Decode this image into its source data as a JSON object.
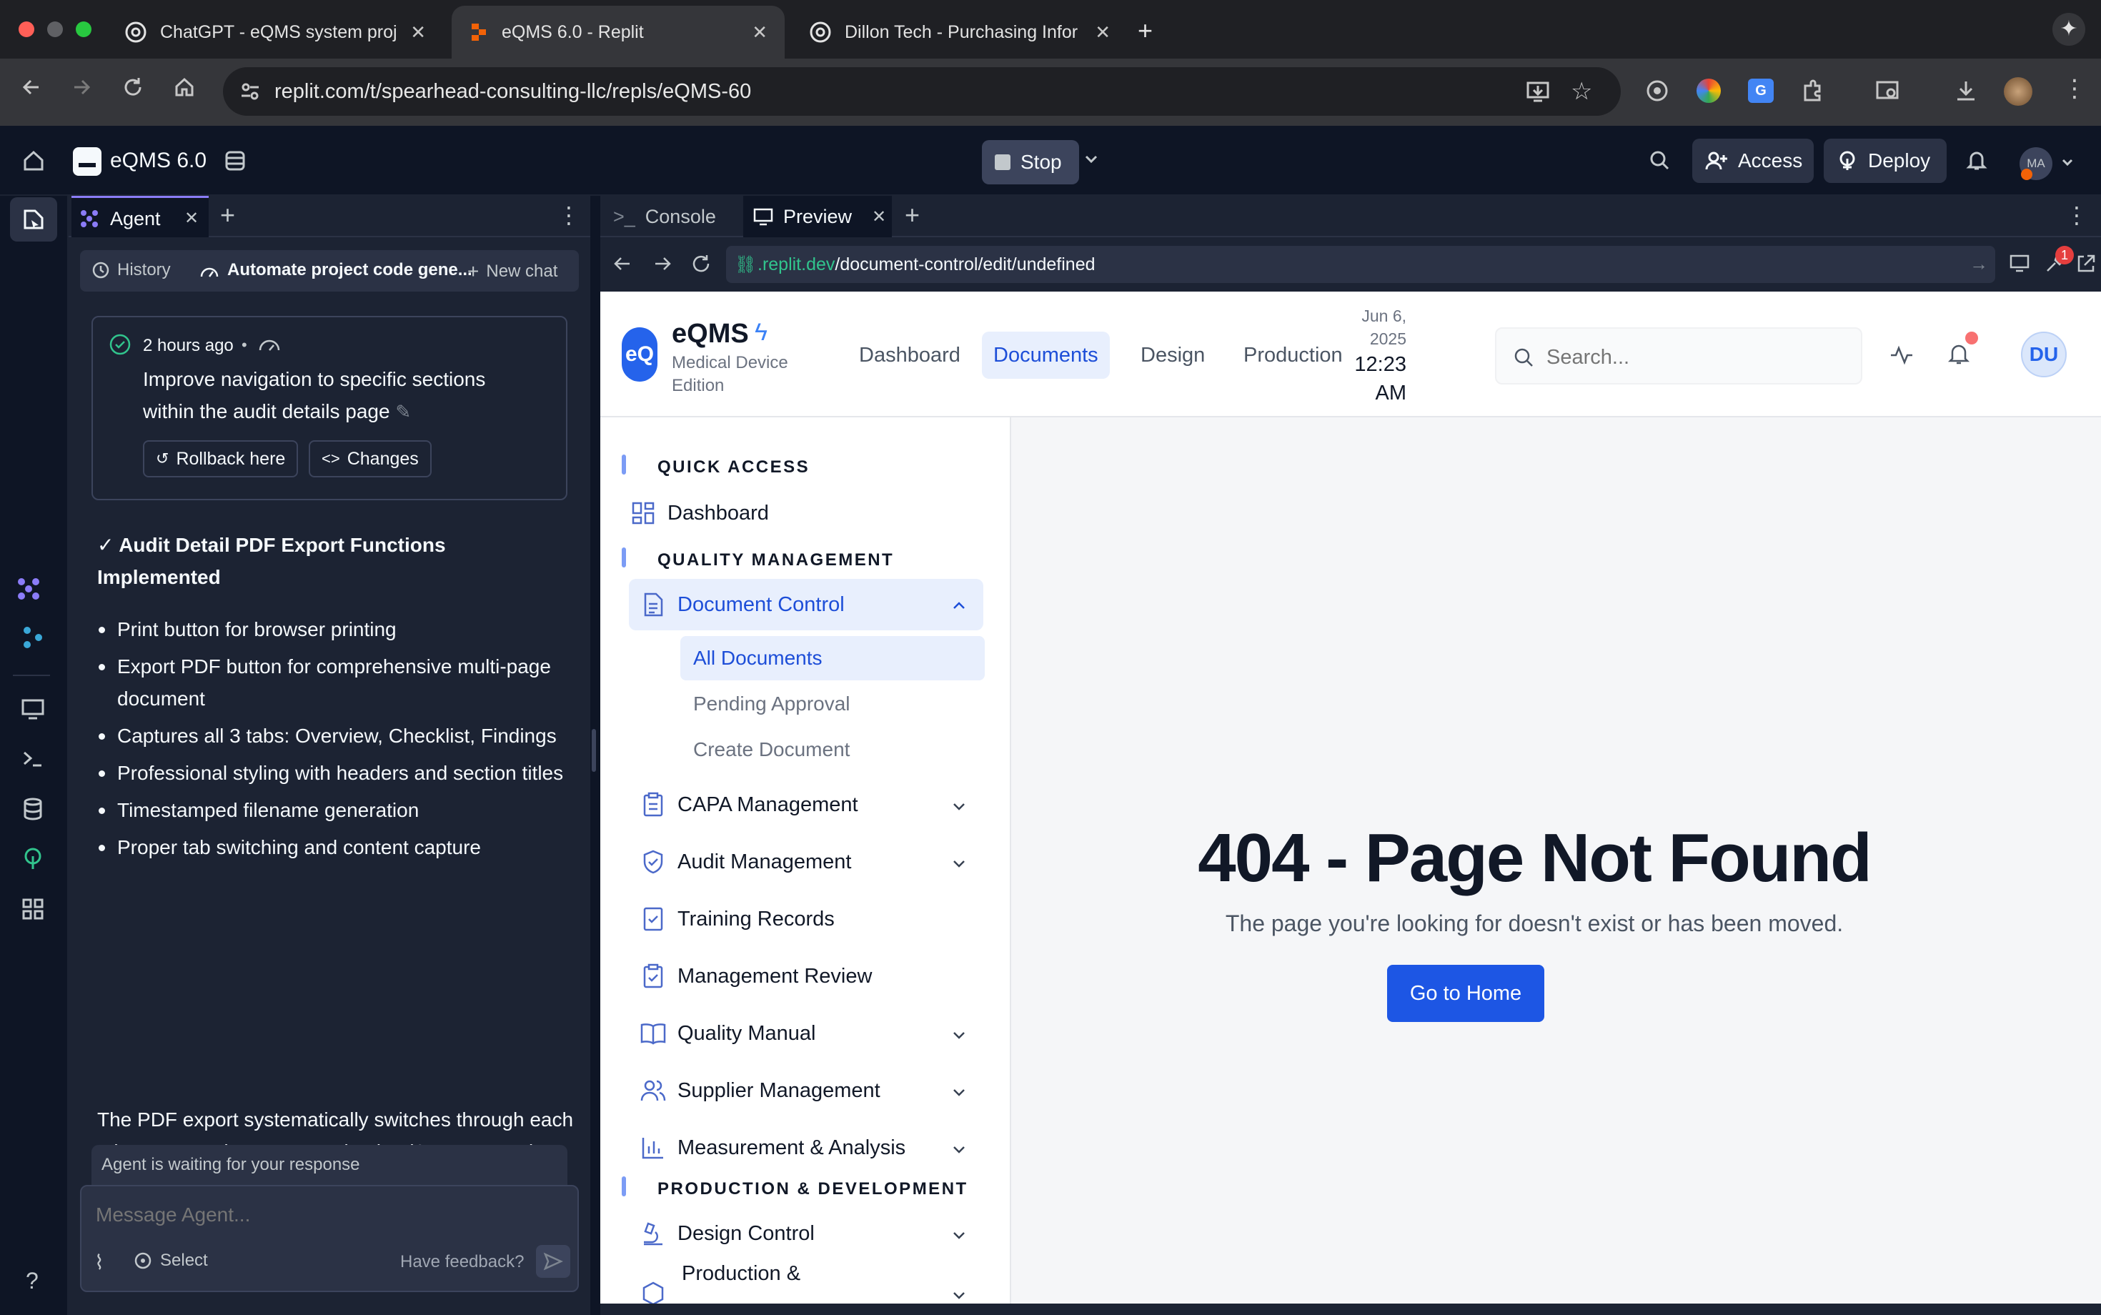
{
  "browser": {
    "tabs": [
      {
        "title": "ChatGPT - eQMS system proj",
        "active": false
      },
      {
        "title": "eQMS 6.0 - Replit",
        "active": true
      },
      {
        "title": "Dillon Tech - Purchasing Infor",
        "active": false
      }
    ],
    "url": "replit.com/t/spearhead-consulting-llc/repls/eQMS-60"
  },
  "replit": {
    "repl_name": "eQMS 6.0",
    "stop_label": "Stop",
    "access_label": "Access",
    "deploy_label": "Deploy",
    "avatar_initials": "MA"
  },
  "agent_panel": {
    "tab_label": "Agent",
    "history_label": "History",
    "chat_title": "Automate project code gene...",
    "new_chat_label": "New chat",
    "checkpoint": {
      "time": "2 hours ago",
      "separator": "•",
      "message": "Improve navigation to specific sections within the audit details page",
      "rollback_label": "Rollback here",
      "changes_label": "Changes"
    },
    "response_heading": "✓ Audit Detail PDF Export Functions Implemented",
    "bullets": [
      "Print button for browser printing",
      "Export PDF button for comprehensive multi-page document",
      "Captures all 3 tabs: Overview, Checklist, Findings",
      "Professional styling with headers and section titles",
      "Timestamped filename generation",
      "Proper tab switching and content capture"
    ],
    "paragraph": "The PDF export systematically switches through each tab, captures the content using html2canvas, and creates a multi-page PDF with professional formatting. Can you test both the Print and Export PDF buttons to confirm they're working correctly for the complete audit documentation?",
    "waiting_text": "Agent is waiting for your response",
    "input_placeholder": "Message Agent...",
    "select_label": "Select",
    "feedback_label": "Have feedback?",
    "help_label": "?"
  },
  "preview_panel": {
    "console_tab": "Console",
    "preview_tab": "Preview",
    "url_host": ".replit.dev",
    "url_path": "/document-control/edit/undefined",
    "notification_count": "1"
  },
  "app": {
    "logo_initials": "eQ",
    "brand": "eQMS",
    "edition": "Medical Device Edition",
    "nav": [
      {
        "label": "Dashboard",
        "active": false
      },
      {
        "label": "Documents",
        "active": true
      },
      {
        "label": "Design",
        "active": false
      },
      {
        "label": "Production",
        "active": false
      }
    ],
    "date_line1": "Jun 6,",
    "date_line2": "2025",
    "time_line1": "12:23",
    "time_line2": "AM",
    "search_placeholder": "Search...",
    "user_initials": "DU",
    "sidebar": {
      "quick_access_heading": "QUICK ACCESS",
      "dashboard": "Dashboard",
      "quality_heading": "QUALITY MANAGEMENT",
      "document_control": "Document Control",
      "doc_subitems": [
        "All Documents",
        "Pending Approval",
        "Create Document"
      ],
      "capa": "CAPA Management",
      "audit": "Audit Management",
      "training": "Training Records",
      "management_review": "Management Review",
      "quality_manual": "Quality Manual",
      "supplier": "Supplier Management",
      "measurement": "Measurement & Analysis",
      "production_heading": "PRODUCTION & DEVELOPMENT",
      "design_control": "Design Control",
      "production_partial": "Production &"
    },
    "error": {
      "title": "404 - Page Not Found",
      "message": "The page you're looking for doesn't exist or has been moved.",
      "button": "Go to Home"
    }
  },
  "colors": {
    "replit_bg": "#0e1525",
    "panel_bg": "#1c2333",
    "accent_blue": "#2563eb",
    "brand_blue": "#3b82f6"
  }
}
